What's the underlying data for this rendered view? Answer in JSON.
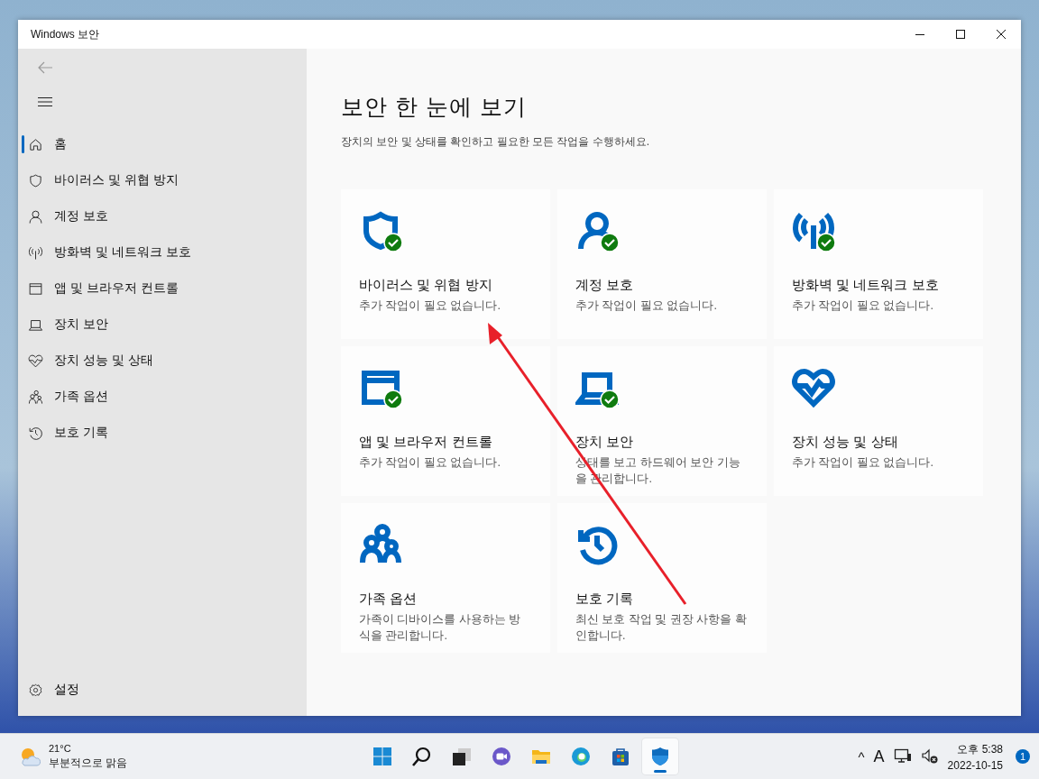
{
  "window": {
    "title": "Windows 보안"
  },
  "sidebar": {
    "items": [
      {
        "label": "홈",
        "kind": "home",
        "selected": true
      },
      {
        "label": "바이러스 및 위협 방지",
        "kind": "shield",
        "selected": false
      },
      {
        "label": "계정 보호",
        "kind": "person",
        "selected": false
      },
      {
        "label": "방화벽 및 네트워크 보호",
        "kind": "antenna",
        "selected": false
      },
      {
        "label": "앱 및 브라우저 컨트롤",
        "kind": "browser",
        "selected": false
      },
      {
        "label": "장치 보안",
        "kind": "laptop",
        "selected": false
      },
      {
        "label": "장치 성능 및 상태",
        "kind": "heart",
        "selected": false
      },
      {
        "label": "가족 옵션",
        "kind": "family",
        "selected": false
      },
      {
        "label": "보호 기록",
        "kind": "history",
        "selected": false
      }
    ],
    "settings": "설정"
  },
  "main": {
    "title": "보안 한 눈에 보기",
    "subtitle": "장치의 보안 및 상태를 확인하고 필요한 모든 작업을 수행하세요.",
    "cards": [
      {
        "title": "바이러스 및 위협 방지",
        "description": "추가 작업이 필요 없습니다.",
        "kind": "shield",
        "checked": true
      },
      {
        "title": "계정 보호",
        "description": "추가 작업이 필요 없습니다.",
        "kind": "person",
        "checked": true
      },
      {
        "title": "방화벽 및 네트워크 보호",
        "description": "추가 작업이 필요 없습니다.",
        "kind": "antenna",
        "checked": true
      },
      {
        "title": "앱 및 브라우저 컨트롤",
        "description": "추가 작업이 필요 없습니다.",
        "kind": "browser",
        "checked": true
      },
      {
        "title": "장치 보안",
        "description": "상태를 보고 하드웨어 보안 기능을 관리합니다.",
        "kind": "laptop",
        "checked": true
      },
      {
        "title": "장치 성능 및 상태",
        "description": "추가 작업이 필요 없습니다.",
        "kind": "heart",
        "checked": false
      },
      {
        "title": "가족 옵션",
        "description": "가족이 디바이스를 사용하는 방식을 관리합니다.",
        "kind": "family",
        "checked": false
      },
      {
        "title": "보호 기록",
        "description": "최신 보호 작업 및 권장 사항을 확인합니다.",
        "kind": "history",
        "checked": false
      }
    ]
  },
  "taskbar": {
    "weather": {
      "temperature": "21°C",
      "condition": "부분적으로 맑음"
    },
    "apps": [
      {
        "kind": "start",
        "selected": false
      },
      {
        "kind": "search",
        "selected": false
      },
      {
        "kind": "taskview",
        "selected": false
      },
      {
        "kind": "chat",
        "selected": false
      },
      {
        "kind": "files",
        "selected": false
      },
      {
        "kind": "edge",
        "selected": false
      },
      {
        "kind": "store",
        "selected": false
      },
      {
        "kind": "security",
        "selected": true
      }
    ],
    "tray": {
      "chevron": "^",
      "ime": "A",
      "time": "오후 5:38",
      "date": "2022-10-15",
      "notifications": "1"
    }
  }
}
